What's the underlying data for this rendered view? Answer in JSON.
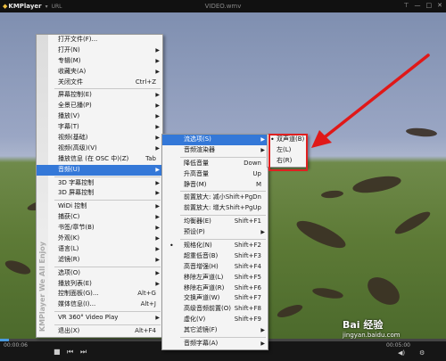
{
  "titlebar": {
    "app": "KMPlayer",
    "menu_label": "URL",
    "title": "VIDEO.wmv"
  },
  "controls": {
    "current_time": "00:00:06",
    "duration": "00:05:00",
    "progress_fraction": 0.02
  },
  "menu1": [
    {
      "label": "打开文件(F)...",
      "shortcut": "",
      "arrow": false
    },
    {
      "label": "打开(N)",
      "shortcut": "",
      "arrow": true
    },
    {
      "label": "专辑(M)",
      "shortcut": "",
      "arrow": true
    },
    {
      "label": "收藏夹(A)",
      "shortcut": "",
      "arrow": true
    },
    {
      "label": "关闭文件",
      "shortcut": "Ctrl+Z",
      "arrow": false
    },
    {
      "sep": true
    },
    {
      "label": "屏幕控制(E)",
      "shortcut": "",
      "arrow": true
    },
    {
      "label": "全景已播(P)",
      "shortcut": "",
      "arrow": true
    },
    {
      "label": "播放(V)",
      "shortcut": "",
      "arrow": true
    },
    {
      "label": "字幕(T)",
      "shortcut": "",
      "arrow": true
    },
    {
      "label": "视频(基础)",
      "shortcut": "",
      "arrow": true
    },
    {
      "label": "视频(高级)(V)",
      "shortcut": "",
      "arrow": true
    },
    {
      "label": "播放信息 (在 OSC 中)(Z)",
      "shortcut": "Tab",
      "arrow": false
    },
    {
      "label": "音频(U)",
      "shortcut": "",
      "arrow": true,
      "hl": true
    },
    {
      "sep": true
    },
    {
      "label": "3D 字幕控制",
      "shortcut": "",
      "arrow": true
    },
    {
      "label": "3D 屏幕控制",
      "shortcut": "",
      "arrow": true
    },
    {
      "sep": true
    },
    {
      "label": "WiDi 控制",
      "shortcut": "",
      "arrow": true
    },
    {
      "label": "捕获(C)",
      "shortcut": "",
      "arrow": true
    },
    {
      "label": "书签/章节(B)",
      "shortcut": "",
      "arrow": true
    },
    {
      "label": "外观(K)",
      "shortcut": "",
      "arrow": true
    },
    {
      "label": "语言(L)",
      "shortcut": "",
      "arrow": true
    },
    {
      "label": "滤镜(R)",
      "shortcut": "",
      "arrow": true
    },
    {
      "sep": true
    },
    {
      "label": "选项(O)",
      "shortcut": "",
      "arrow": true
    },
    {
      "label": "播放列表(E)",
      "shortcut": "",
      "arrow": true
    },
    {
      "label": "控制面板(G)...",
      "shortcut": "Alt+G",
      "arrow": false
    },
    {
      "label": "媒体信息(I)...",
      "shortcut": "Alt+J",
      "arrow": false
    },
    {
      "sep": true
    },
    {
      "label": "VR 360° Video Play",
      "shortcut": "",
      "arrow": true
    },
    {
      "sep": true
    },
    {
      "label": "退出(X)",
      "shortcut": "Alt+F4",
      "arrow": false
    }
  ],
  "menu1_side": "KMPlayer We All Enjoy",
  "menu2": [
    {
      "label": "流选项(S)",
      "shortcut": "",
      "arrow": true,
      "hl": true
    },
    {
      "label": "音频渲染器",
      "shortcut": "",
      "arrow": true
    },
    {
      "sep": true
    },
    {
      "label": "降低音量",
      "shortcut": "Down",
      "arrow": false
    },
    {
      "label": "升高音量",
      "shortcut": "Up",
      "arrow": false
    },
    {
      "label": "静音(M)",
      "shortcut": "M",
      "arrow": false
    },
    {
      "sep": true
    },
    {
      "label": "前置放大: 减小",
      "shortcut": "Shift+PgDn",
      "arrow": false
    },
    {
      "label": "前置放大: 增大",
      "shortcut": "Shift+PgUp",
      "arrow": false
    },
    {
      "sep": true
    },
    {
      "label": "均衡器(E)",
      "shortcut": "Shift+F1",
      "arrow": false
    },
    {
      "label": "预设(P)",
      "shortcut": "",
      "arrow": true
    },
    {
      "sep": true
    },
    {
      "label": "规格化(N)",
      "shortcut": "Shift+F2",
      "arrow": false,
      "check": true
    },
    {
      "label": "超重低音(B)",
      "shortcut": "Shift+F3",
      "arrow": false
    },
    {
      "label": "高音增强(H)",
      "shortcut": "Shift+F4",
      "arrow": false
    },
    {
      "label": "移除左声道(L)",
      "shortcut": "Shift+F5",
      "arrow": false
    },
    {
      "label": "移除右声道(R)",
      "shortcut": "Shift+F6",
      "arrow": false
    },
    {
      "label": "交换声道(W)",
      "shortcut": "Shift+F7",
      "arrow": false
    },
    {
      "label": "高级音频前置(O)",
      "shortcut": "Shift+F8",
      "arrow": false
    },
    {
      "label": "虚化(V)",
      "shortcut": "Shift+F9",
      "arrow": false
    },
    {
      "label": "其它滤镜(F)",
      "shortcut": "",
      "arrow": true
    },
    {
      "sep": true
    },
    {
      "label": "音频字幕(A)",
      "shortcut": "",
      "arrow": true
    }
  ],
  "menu3": [
    {
      "label": "双声道(B)",
      "check": true
    },
    {
      "label": "左(L)"
    },
    {
      "label": "右(R)"
    }
  ],
  "watermark": {
    "line1": "Bai 经验",
    "line2": "jingyan.baidu.com"
  }
}
